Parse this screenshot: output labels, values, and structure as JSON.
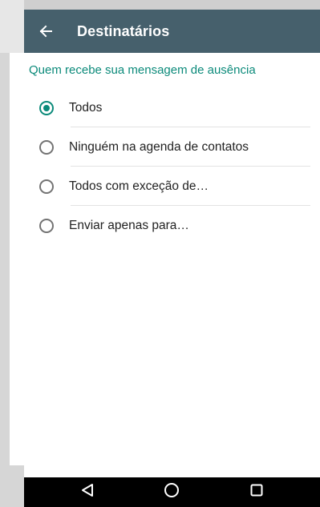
{
  "toolbar": {
    "back_icon": "arrow-left-icon",
    "title": "Destinatários"
  },
  "section": {
    "header": "Quem recebe sua mensagem de ausência"
  },
  "options": [
    {
      "label": "Todos",
      "checked": true
    },
    {
      "label": "Ninguém na agenda de contatos",
      "checked": false
    },
    {
      "label": "Todos com exceção de…",
      "checked": false
    },
    {
      "label": "Enviar apenas para…",
      "checked": false
    }
  ],
  "navbar": {
    "back_icon": "triangle-back-icon",
    "home_icon": "circle-home-icon",
    "recents_icon": "square-recents-icon"
  },
  "colors": {
    "toolbar": "#46606c",
    "accent": "#0b8a7a",
    "navbar": "#000000"
  }
}
